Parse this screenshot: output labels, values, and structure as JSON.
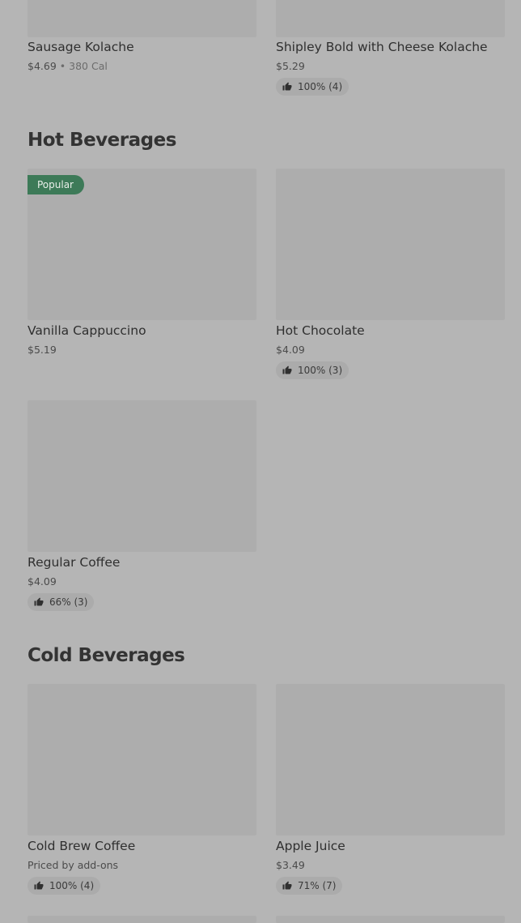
{
  "sections": {
    "kolache": {
      "items": [
        {
          "name": "Sausage Kolache",
          "price": "$4.69",
          "separator": "•",
          "calories": "380 Cal"
        },
        {
          "name": "Shipley Bold with Cheese Kolache",
          "price": "$5.29",
          "rating": "100% (4)"
        }
      ]
    },
    "hot_beverages": {
      "title": "Hot Beverages",
      "items": [
        {
          "name": "Vanilla Cappuccino",
          "price": "$5.19",
          "badge": "Popular"
        },
        {
          "name": "Hot Chocolate",
          "price": "$4.09",
          "rating": "100% (3)"
        },
        {
          "name": "Regular Coffee",
          "price": "$4.09",
          "rating": "66% (3)"
        }
      ]
    },
    "cold_beverages": {
      "title": "Cold Beverages",
      "items": [
        {
          "name": "Cold Brew Coffee",
          "price": "Priced by add-ons",
          "rating": "100% (4)"
        },
        {
          "name": "Apple Juice",
          "price": "$3.49",
          "rating": "71% (7)"
        }
      ]
    }
  },
  "icons": {
    "rating": "thumbs-up-icon"
  },
  "colors": {
    "page_background": "#b5b5b5",
    "image_placeholder": "#adadad",
    "badge_background": "#3d7a58",
    "rating_pill_background": "#ababab"
  }
}
